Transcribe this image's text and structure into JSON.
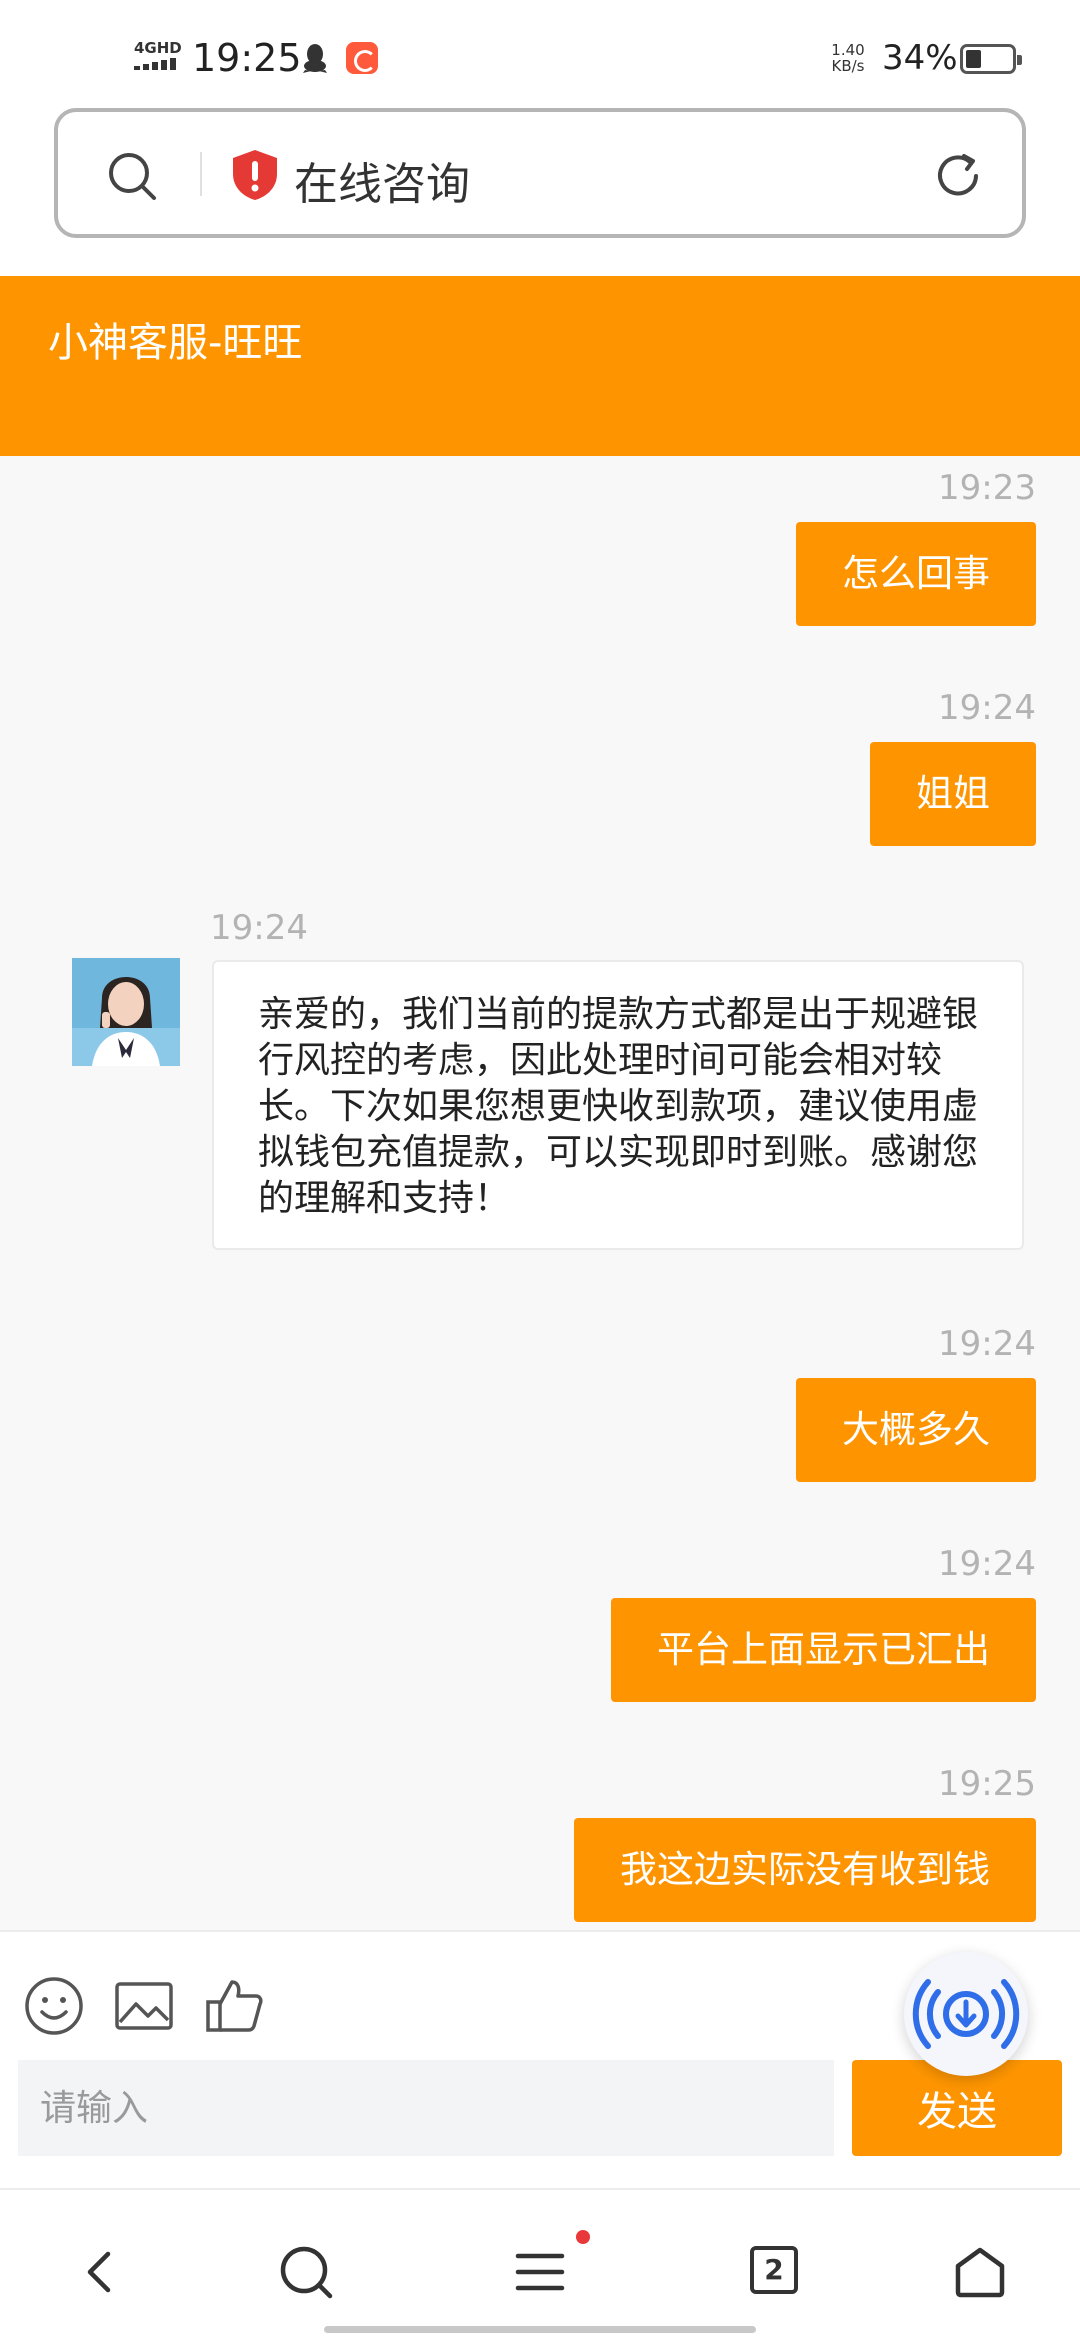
{
  "status_bar": {
    "network": "4GHD",
    "time": "19:25",
    "speed_value": "1.40",
    "speed_unit": "KB/s",
    "battery": "34%",
    "battery_level": 0.34,
    "icons": [
      "qq-icon",
      "app-notification-icon",
      "battery-icon"
    ]
  },
  "address_bar": {
    "title": "在线咨询",
    "icons": [
      "search-icon",
      "shield-warning-icon",
      "reload-icon"
    ]
  },
  "chat": {
    "title": "小神客服-旺旺",
    "messages": [
      {
        "time": "19:23",
        "text": "怎么回事",
        "from": "user"
      },
      {
        "time": "19:24",
        "text": "姐姐",
        "from": "user"
      },
      {
        "time": "19:24",
        "text": "亲爱的，我们当前的提款方式都是出于规避银行风控的考虑，因此处理时间可能会相对较长。下次如果您想更快收到款项，建议使用虚拟钱包充值提款，可以实现即时到账。感谢您的理解和支持！",
        "from": "agent"
      },
      {
        "time": "19:24",
        "text": "大概多久",
        "from": "user"
      },
      {
        "time": "19:24",
        "text": "平台上面显示已汇出",
        "from": "user"
      },
      {
        "time": "19:25",
        "text": "我这边实际没有收到钱",
        "from": "user"
      }
    ]
  },
  "input": {
    "placeholder": "请输入",
    "send_label": "发送",
    "tools": [
      "emoji-icon",
      "image-icon",
      "thumbs-up-icon"
    ]
  },
  "bottom_nav": {
    "tab_count": "2",
    "items": [
      "back-icon",
      "search-icon",
      "menu-icon",
      "tabs-icon",
      "home-icon"
    ]
  },
  "colors": {
    "accent": "#fe9500",
    "background": "#f8f8f8",
    "timestamp": "#b3b3b3"
  }
}
